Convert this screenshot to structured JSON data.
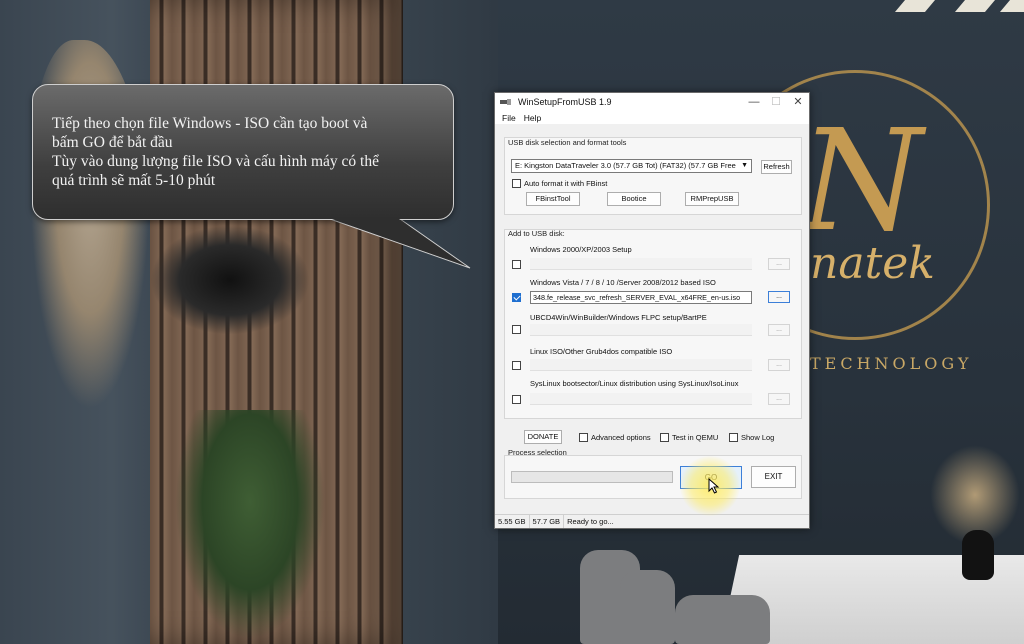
{
  "callout": {
    "lines": [
      "Tiếp theo chọn file Windows - ISO cần tạo boot và",
      "bấm GO để bắt đầu",
      "Tùy vào dung lượng file ISO và cấu hình máy có thể",
      "quá trình sẽ mất 5-10 phút"
    ]
  },
  "background": {
    "logo_text": "natek",
    "logo_tagline": "TECHNOLOGY"
  },
  "window": {
    "title": "WinSetupFromUSB 1.9",
    "controls": {
      "minimize": "—",
      "maximize": "☐",
      "close": "✕"
    },
    "menu": [
      "File",
      "Help"
    ],
    "usb_group": {
      "label": "USB disk selection and format tools",
      "disk_value": "E: Kingston DataTraveler 3.0 (57.7 GB Tot) (FAT32) (57.7 GB Free",
      "refresh_label": "Refresh",
      "auto_format_label": "Auto format it with FBinst",
      "auto_format_checked": false,
      "tools": [
        "FBinstTool",
        "Bootice",
        "RMPrepUSB"
      ]
    },
    "add_group": {
      "label": "Add to USB disk:",
      "items": [
        {
          "label": "Windows 2000/XP/2003 Setup",
          "checked": false,
          "value": "",
          "browse": "..."
        },
        {
          "label": "Windows Vista / 7 / 8 / 10 /Server 2008/2012 based ISO",
          "checked": true,
          "value": "348.fe_release_svc_refresh_SERVER_EVAL_x64FRE_en-us.iso",
          "browse": "..."
        },
        {
          "label": "UBCD4Win/WinBuilder/Windows FLPC setup/BartPE",
          "checked": false,
          "value": "",
          "browse": "..."
        },
        {
          "label": "Linux ISO/Other Grub4dos compatible ISO",
          "checked": false,
          "value": "",
          "browse": "..."
        },
        {
          "label": "SysLinux bootsector/Linux distribution using SysLinux/IsoLinux",
          "checked": false,
          "value": "",
          "browse": "..."
        }
      ]
    },
    "options": {
      "donate_label": "DONATE",
      "advanced_label": "Advanced options",
      "test_qemu_label": "Test in QEMU",
      "show_log_label": "Show Log"
    },
    "process": {
      "label": "Process selection",
      "progress": 0,
      "go_label": "GO",
      "exit_label": "EXIT"
    },
    "status": [
      "5.55 GB",
      "57.7 GB",
      "Ready to go..."
    ]
  }
}
